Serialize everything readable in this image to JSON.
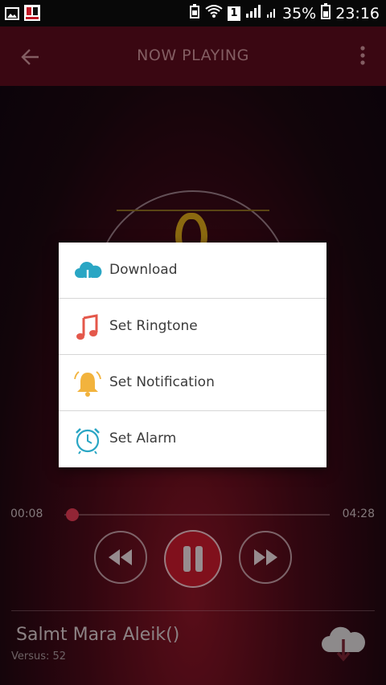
{
  "status_bar": {
    "battery_percent": "35%",
    "time": "23:16",
    "sim_badge": "1"
  },
  "app_bar": {
    "title": "NOW PLAYING"
  },
  "dialog": {
    "items": [
      {
        "label": "Download",
        "icon": "cloud-download-icon",
        "color": "#2aa6c4"
      },
      {
        "label": "Set Ringtone",
        "icon": "music-note-icon",
        "color": "#e4584b"
      },
      {
        "label": "Set Notification",
        "icon": "bell-icon",
        "color": "#f2b33d"
      },
      {
        "label": "Set Alarm",
        "icon": "alarm-clock-icon",
        "color": "#2aa6c4"
      }
    ]
  },
  "player": {
    "current_time": "00:08",
    "total_time": "04:28",
    "progress": 0.03,
    "song_title": "Salmt Mara Aleik()",
    "song_subtitle": "Versus: 52",
    "accent_color": "#c51a2c"
  }
}
